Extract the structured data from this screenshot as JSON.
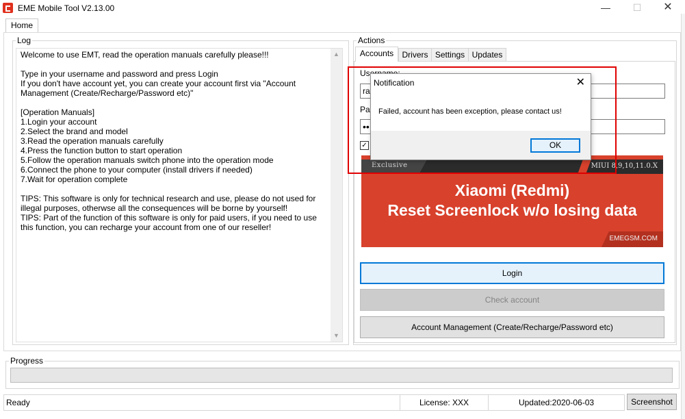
{
  "window": {
    "title": "EME Mobile Tool V2.13.00",
    "minimize_glyph": "—",
    "maximize_glyph": "☐",
    "close_glyph": "✕"
  },
  "main_tabs": [
    {
      "label": "Home"
    }
  ],
  "log": {
    "title": "Log",
    "text": "Welcome to use EMT, read the operation manuals carefully please!!!\n\nType in your username and password and press Login\nIf you don't have account yet, you can create your account first via \"Account Management (Create/Recharge/Password etc)\"\n\n[Operation Manuals]\n1.Login your account\n2.Select the brand and model\n3.Read the operation manuals carefully\n4.Press the function button to start operation\n5.Follow the operation manuals switch phone into the operation mode\n6.Connect the phone to your computer (install drivers if needed)\n7.Wait for operation complete\n\nTIPS: This software is only for technical research and use, please do not used for illegal purposes, otherwse all the consequences will be borne by yourself!\nTIPS: Part of the function of this software is only for paid users, if you need to use this function, you can recharge your account from one of our reseller!",
    "scroll_up_glyph": "▲",
    "scroll_down_glyph": "▼"
  },
  "actions": {
    "title": "Actions",
    "tabs": [
      {
        "label": "Accounts"
      },
      {
        "label": "Drivers"
      },
      {
        "label": "Settings"
      },
      {
        "label": "Updates"
      }
    ],
    "username_label": "Username:",
    "username_value": "ran",
    "password_label": "Password:",
    "password_value": "••",
    "remember_checked_glyph": "✓",
    "banner": {
      "tag": "Exclusive",
      "miui": "MIUI 8,9,10,11.0.X",
      "line1": "Xiaomi (Redmi)",
      "line2": "Reset Screenlock w/o losing data",
      "site": "EMEGSM.COM",
      "background_color": "#d8412c"
    },
    "login_button": "Login",
    "check_account_button": "Check account",
    "account_management_button": "Account Management (Create/Recharge/Password etc)"
  },
  "progress": {
    "title": "Progress",
    "value_percent": 0
  },
  "status": {
    "state": "Ready",
    "license": "License: XXX",
    "updated": "Updated:2020-06-03",
    "screenshot_button": "Screenshot"
  },
  "dialog": {
    "title": "Notification",
    "message": "Failed, account has been exception, please contact us!",
    "ok_button": "OK",
    "close_glyph": "✕",
    "highlight_color": "#e00000"
  },
  "colors": {
    "accent": "#0078d7",
    "progress_fill": "#06b025"
  }
}
